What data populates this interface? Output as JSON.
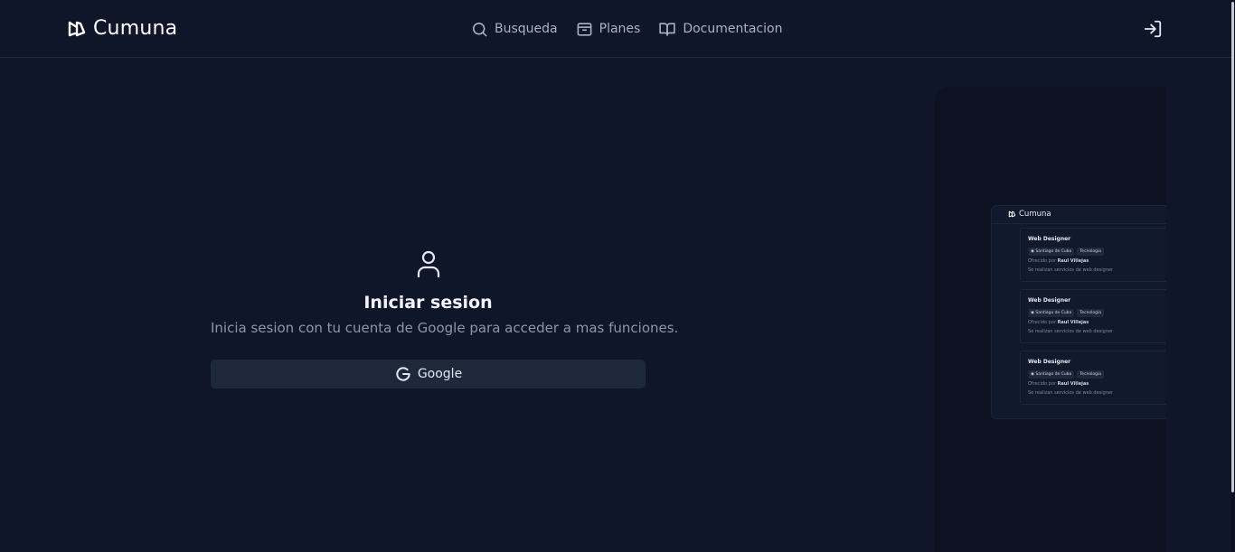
{
  "header": {
    "brand_name": "Cumuna",
    "nav": [
      {
        "label": "Busqueda",
        "icon": "search-icon"
      },
      {
        "label": "Planes",
        "icon": "archive-icon"
      },
      {
        "label": "Documentacion",
        "icon": "book-open-icon"
      }
    ],
    "login_icon": "log-in-icon"
  },
  "login": {
    "icon": "user-icon",
    "title": "Iniciar sesion",
    "subtitle": "Inicia sesion con tu cuenta de Google para acceder a mas funciones.",
    "google_button_label": "Google",
    "google_button_icon": "google-icon"
  },
  "preview": {
    "brand_name": "Cumuna",
    "cards": [
      {
        "title": "Web Designer",
        "location": "Santiago de Cuba",
        "category": "Tecnologia",
        "offered_by_label": "Ofrecido por",
        "offered_by_name": "Raul Villejas",
        "description": "Se realizan servicios de web designer"
      },
      {
        "title": "Web Designer",
        "location": "Santiago de Cuba",
        "category": "Tecnologia",
        "offered_by_label": "Ofrecido por",
        "offered_by_name": "Raul Villejas",
        "description": "Se realizan servicios de web designer"
      },
      {
        "title": "Web Designer",
        "location": "Santiago de Cuba",
        "category": "Tecnologia",
        "offered_by_label": "Ofrecido por",
        "offered_by_name": "Raul Villejas",
        "description": "Se realizan servicios de web designer"
      }
    ]
  },
  "colors": {
    "background": "#0f1629",
    "border": "#232c40",
    "button_bg": "#1e283b",
    "muted_text": "#8c96a8",
    "text": "#f1f5f9"
  }
}
